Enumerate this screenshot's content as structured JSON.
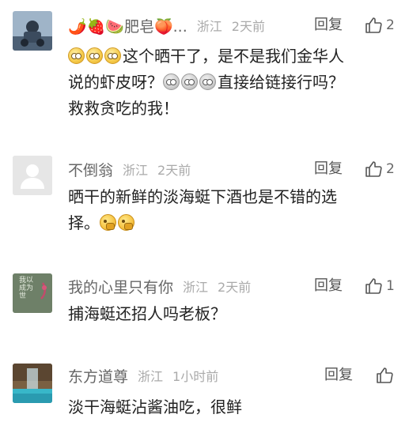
{
  "comments": [
    {
      "username": "🌶️🍓🍉肥皂🍑...",
      "region": "浙江",
      "time": "2天前",
      "reply_label": "回复",
      "like_count": "2",
      "line1_text": "这个晒干了，是不是我们金华人",
      "line2_text_a": "说的虾皮呀？",
      "line2_text_b": "直接给链接行吗？",
      "line3_text": "救救贪吃的我！"
    },
    {
      "username": "不倒翁",
      "region": "浙江",
      "time": "2天前",
      "reply_label": "回复",
      "like_count": "2",
      "line1_text": "晒干的新鲜的淡海蜓下酒也是不错的选",
      "line2_text": "择。"
    },
    {
      "username": "我的心里只有你",
      "region": "浙江",
      "time": "2天前",
      "reply_label": "回复",
      "like_count": "1",
      "avatar_text": "我以成为世",
      "line1_text": "捕海蜓还招人吗老板？"
    },
    {
      "username": "东方道尊",
      "region": "浙江",
      "time": "1小时前",
      "reply_label": "回复",
      "like_count": "",
      "line1_text": "淡干海蜓沾酱油吃，很鲜"
    }
  ],
  "icons": {
    "like": "thumbs-up-outline-icon",
    "emoji_flushed": "flushed-face-emoji",
    "emoji_gray": "gray-face-emoji",
    "emoji_thinking": "thinking-face-emoji"
  },
  "colors": {
    "username": "#666666",
    "subtle": "#aaaaaa",
    "text": "#222222"
  }
}
